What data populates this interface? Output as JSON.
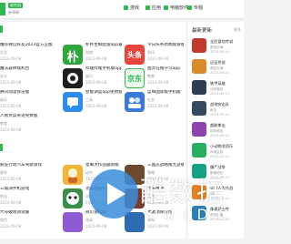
{
  "header": {
    "brand_badge": "软件园",
    "brand_sub": "安卓网",
    "nav": [
      {
        "label": "游戏",
        "icon": "gamepad-icon"
      },
      {
        "label": "应用",
        "icon": "app-grid-icon"
      },
      {
        "label": "电脑软件",
        "icon": "computer-icon"
      },
      {
        "label": "专题",
        "icon": "folder-icon"
      }
    ],
    "accent_color": "#2fb84f"
  },
  "main_top": [
    {
      "title": "推荐微信好友2023官方正版",
      "category": "社交",
      "date": "2023-09-08"
    },
    {
      "title": "朴朴生鲜配送app最新版本",
      "category": "购物",
      "date": "2023-09-08",
      "thumb_text": "朴"
    },
    {
      "title": "今日头条新闻极速版",
      "category": "资讯",
      "date": "2023-09-08",
      "thumb_text": "头条"
    },
    {
      "title": "魔法森林福利合",
      "category": "社交",
      "date": "2023-09-08"
    },
    {
      "title": "哔哩哔哩手机版app",
      "category": "娱乐",
      "date": "2023-09-08"
    },
    {
      "title": "图灵在线学习app",
      "category": "教育",
      "date": "2023-09-08",
      "thumb_text": "京东"
    },
    {
      "title": "腾讯动漫会员版",
      "category": "娱乐",
      "date": "2023-09-08"
    },
    {
      "title": "智能调度app免费版",
      "category": "工具",
      "date": "2023-09-08"
    },
    {
      "title": "蓝莓国际版手机版",
      "category": "社交",
      "date": "2023-09-08"
    },
    {
      "title": "人教点读英语免费版",
      "category": "教育",
      "date": "2023-09-08"
    }
  ],
  "main_bottom": [
    {
      "title": "疯狂行动汽车驾驶游戏",
      "category": "赛车",
      "date": "2023-09-08"
    },
    {
      "title": "猎鹰大作战最新版",
      "category": "动作",
      "date": "2023-09-08"
    },
    {
      "title": "三国志战略版九游版",
      "category": "策略",
      "date": "2023-09-08"
    },
    {
      "title": "三角洲手机游戏",
      "category": "射击",
      "date": "2023-09-08"
    },
    {
      "title": "功夫熊猫打僵尸",
      "category": "动作",
      "date": "2023-09-08"
    },
    {
      "title": "代号破晓",
      "category": "角色",
      "date": "2023-09-08"
    },
    {
      "title": "代号破晓测试服",
      "category": "角色",
      "date": "2023-09-08"
    },
    {
      "title": "萌幻冒险家",
      "category": "休闲",
      "date": "2023-09-08"
    },
    {
      "title": "像素消除冒险",
      "category": "休闲",
      "date": "2023-09-08"
    }
  ],
  "sidebar": {
    "title": "最新更新",
    "more": "更多",
    "items": [
      {
        "name": "全民冒险传说",
        "category": "角色扮演",
        "date": "2023-09-14"
      },
      {
        "name": "远征传说",
        "category": "角色扮演",
        "date": "2023-09-14"
      },
      {
        "name": "铁甲英雄",
        "category": "动作冒险",
        "date": "2023-09-14"
      },
      {
        "name": "战地突击队",
        "category": "射击",
        "date": "2023-09-14"
      },
      {
        "name": "超能拳击",
        "category": "体育竞技",
        "date": "2023-09-14"
      },
      {
        "name": "小动物消消乐",
        "category": "休闲益智",
        "date": "2023-09-14"
      },
      {
        "name": "僵尸战争",
        "category": "策略塔防",
        "date": "2023-09-14"
      },
      {
        "name": "火箭人大作战",
        "category": "动作",
        "date": "2023-09-14"
      },
      {
        "name": "像素武士传",
        "category": "角色扮演",
        "date": "2023-09-14"
      }
    ]
  },
  "watermark": {
    "text": "酷数据",
    "sub": "KUIDC"
  }
}
